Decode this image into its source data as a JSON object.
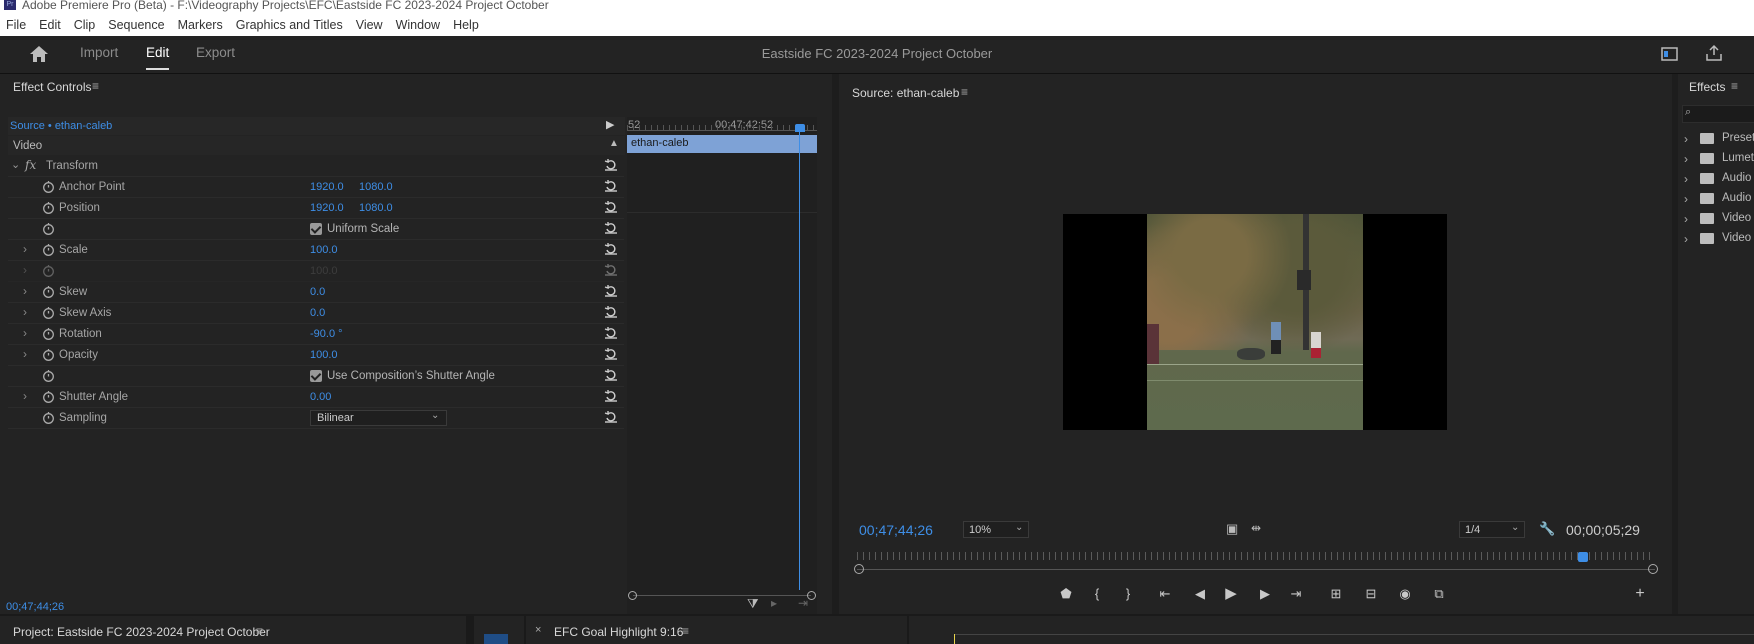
{
  "window": {
    "title": "Adobe Premiere Pro (Beta) - F:\\Videography Projects\\EFC\\Eastside FC 2023-2024 Project October",
    "app_icon_text": "Pr"
  },
  "menu": [
    "File",
    "Edit",
    "Clip",
    "Sequence",
    "Markers",
    "Graphics and Titles",
    "View",
    "Window",
    "Help"
  ],
  "workspace": {
    "tabs": [
      "Import",
      "Edit",
      "Export"
    ],
    "active": "Edit",
    "project_title": "Eastside FC 2023-2024 Project October"
  },
  "effect_controls": {
    "title": "Effect Controls",
    "source_label": "Source • ethan-caleb",
    "section": "Video",
    "fx_label": "fx",
    "effect": "Transform",
    "rows": [
      {
        "label": "Anchor Point",
        "v1": "1920.0",
        "v2": "1080.0"
      },
      {
        "label": "Position",
        "v1": "1920.0",
        "v2": "1080.0"
      },
      {
        "label": "",
        "check": "Uniform Scale"
      },
      {
        "label": "Scale",
        "v1": "100.0"
      },
      {
        "label": "",
        "v1": "100.0",
        "disabled": true
      },
      {
        "label": "Skew",
        "v1": "0.0"
      },
      {
        "label": "Skew Axis",
        "v1": "0.0"
      },
      {
        "label": "Rotation",
        "v1": "-90.0 °"
      },
      {
        "label": "Opacity",
        "v1": "100.0"
      },
      {
        "label": "",
        "check": "Use Composition’s Shutter Angle"
      },
      {
        "label": "Shutter Angle",
        "v1": "0.00"
      },
      {
        "label": "Sampling",
        "select": "Bilinear"
      }
    ],
    "timecode": "00;47;44;26",
    "ruler_start": "52",
    "ruler_time": "00;47;42;52",
    "clip_name": "ethan-caleb"
  },
  "source_monitor": {
    "title": "Source: ethan-caleb",
    "timecode": "00;47;44;26",
    "zoom": "10%",
    "resolution": "1/4",
    "duration": "00;00;05;29",
    "playhead_fraction": 0.91
  },
  "effects_panel": {
    "title": "Effects",
    "items": [
      {
        "name": "Presets",
        "icon": "preset-folder-icon"
      },
      {
        "name": "Lumetri Presets",
        "icon": "preset-folder-icon"
      },
      {
        "name": "Audio Effects",
        "icon": "folder-icon"
      },
      {
        "name": "Audio Transitions",
        "icon": "folder-icon"
      },
      {
        "name": "Video Effects",
        "icon": "folder-icon"
      },
      {
        "name": "Video Transitions",
        "icon": "folder-icon"
      }
    ]
  },
  "bottom": {
    "project_tab": "Project: Eastside FC 2023-2024 Project October",
    "sequence_tab": "EFC Goal Highlight 9:16"
  },
  "colors": {
    "accent": "#3e8ee6",
    "clip": "#7ea2d6",
    "panel": "#232323",
    "bg": "#1d1d1d"
  }
}
